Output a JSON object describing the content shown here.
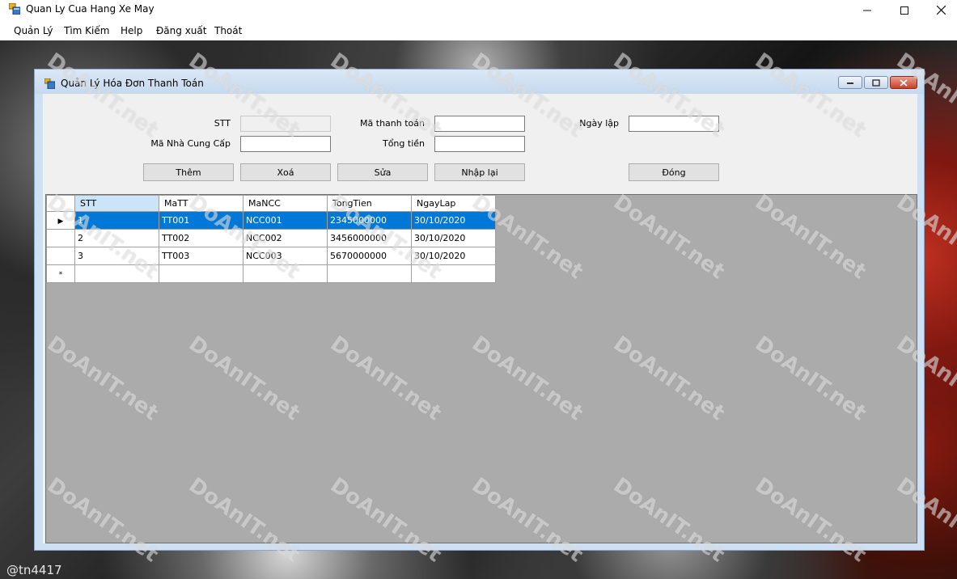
{
  "window": {
    "title": "Quan Ly Cua Hang Xe May",
    "minimize_icon": "minimize-icon",
    "maximize_icon": "maximize-icon",
    "close_icon": "close-icon"
  },
  "menu": {
    "items": [
      "Quản Lý",
      "Tìm Kiếm",
      "Help",
      "Đăng xuất",
      "Thoát"
    ]
  },
  "child_window": {
    "title": "Quản Lý Hóa Đơn Thanh Toán"
  },
  "form": {
    "stt_label": "STT",
    "stt_value": "",
    "mancc_label": "Mã Nhà Cung Cấp",
    "mancc_value": "",
    "matt_label": "Mã thanh toán",
    "matt_value": "",
    "tongtien_label": "Tổng tiền",
    "tongtien_value": "",
    "ngaylap_label": "Ngày lập",
    "ngaylap_value": ""
  },
  "buttons": {
    "them": "Thêm",
    "xoa": "Xoá",
    "sua": "Sửa",
    "nhaplai": "Nhập lại",
    "dong": "Đóng"
  },
  "grid": {
    "columns": [
      "STT",
      "MaTT",
      "MaNCC",
      "TongTien",
      "NgayLap"
    ],
    "rows": [
      [
        "1",
        "TT001",
        "NCC001",
        "2345000000",
        "30/10/2020"
      ],
      [
        "2",
        "TT002",
        "NCC002",
        "3456000000",
        "30/10/2020"
      ],
      [
        "3",
        "TT003",
        "NCC003",
        "5670000000",
        "30/10/2020"
      ]
    ],
    "current_row_marker": "▶",
    "new_row_marker": "*"
  },
  "footer_tag": "@tn4417",
  "watermark": "DoAnIT.net",
  "colors": {
    "selection": "#0078d7",
    "grid_background": "#ababab",
    "client_background": "#f0f0f0"
  }
}
